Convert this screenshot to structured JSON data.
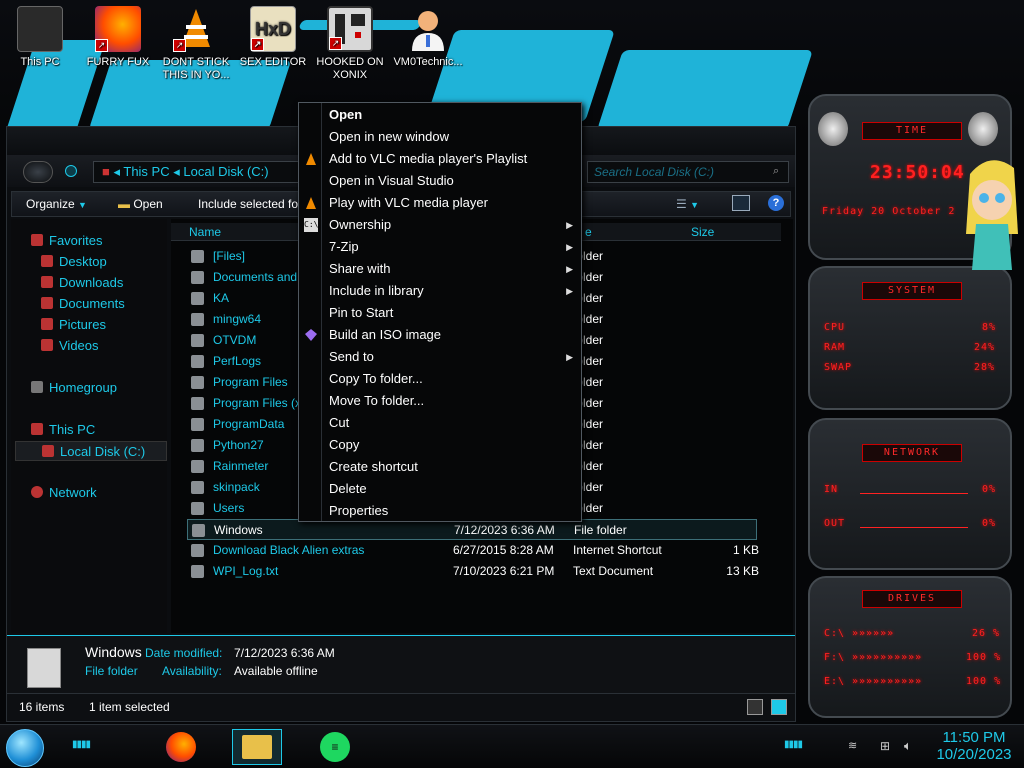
{
  "desktop": {
    "icons": [
      {
        "label": "This PC"
      },
      {
        "label": "FURRY FUX"
      },
      {
        "label": "DONT STICK THIS IN YO..."
      },
      {
        "label": "SEX EDITOR"
      },
      {
        "label": "HOOKED ON XONIX"
      },
      {
        "label": "VM0Technic..."
      }
    ]
  },
  "explorer": {
    "address": [
      "This PC",
      "Local Disk (C:)"
    ],
    "search_placeholder": "Search Local Disk (C:)",
    "toolbar": {
      "organize": "Organize",
      "open": "Open",
      "include": "Include selected fol"
    },
    "sidebar": {
      "favorites": "Favorites",
      "desktop": "Desktop",
      "downloads": "Downloads",
      "documents": "Documents",
      "pictures": "Pictures",
      "videos": "Videos",
      "homegroup": "Homegroup",
      "this_pc": "This PC",
      "local_disk": "Local Disk (C:)",
      "network": "Network"
    },
    "columns": {
      "name": "Name",
      "type": "e",
      "size": "Size"
    },
    "files": [
      {
        "name": "[Files]",
        "date": "",
        "type": "folder",
        "size": ""
      },
      {
        "name": "Documents and Se",
        "date": "",
        "type": "folder",
        "size": ""
      },
      {
        "name": "KA",
        "date": "",
        "type": "folder",
        "size": ""
      },
      {
        "name": "mingw64",
        "date": "",
        "type": "folder",
        "size": ""
      },
      {
        "name": "OTVDM",
        "date": "",
        "type": "folder",
        "size": ""
      },
      {
        "name": "PerfLogs",
        "date": "",
        "type": "folder",
        "size": ""
      },
      {
        "name": "Program Files",
        "date": "",
        "type": "folder",
        "size": ""
      },
      {
        "name": "Program Files (x86",
        "date": "",
        "type": "folder",
        "size": ""
      },
      {
        "name": "ProgramData",
        "date": "",
        "type": "folder",
        "size": ""
      },
      {
        "name": "Python27",
        "date": "",
        "type": "folder",
        "size": ""
      },
      {
        "name": "Rainmeter",
        "date": "",
        "type": "folder",
        "size": ""
      },
      {
        "name": "skinpack",
        "date": "",
        "type": "folder",
        "size": ""
      },
      {
        "name": "Users",
        "date": "",
        "type": "folder",
        "size": ""
      },
      {
        "name": "Windows",
        "date": "7/12/2023 6:36 AM",
        "type": "File folder",
        "size": ""
      },
      {
        "name": "Download Black Alien extras",
        "date": "6/27/2015 8:28 AM",
        "type": "Internet Shortcut",
        "size": "1 KB"
      },
      {
        "name": "WPI_Log.txt",
        "date": "7/10/2023 6:21 PM",
        "type": "Text Document",
        "size": "13 KB"
      }
    ],
    "details": {
      "name": "Windows",
      "date_label": "Date modified:",
      "date_value": "7/12/2023 6:36 AM",
      "type": "File folder",
      "avail_label": "Availability:",
      "avail_value": "Available offline"
    },
    "status": {
      "count": "16 items",
      "selected": "1 item selected"
    }
  },
  "context_menu": [
    {
      "label": "Open",
      "bold": true,
      "submenu": false,
      "icon": ""
    },
    {
      "label": "Open in new window",
      "submenu": false,
      "icon": ""
    },
    {
      "label": "Add to VLC media player's Playlist",
      "submenu": false,
      "icon": "vlc-icon"
    },
    {
      "label": "Open in Visual Studio",
      "submenu": false,
      "icon": ""
    },
    {
      "label": "Play with VLC media player",
      "submenu": false,
      "icon": "vlc-icon"
    },
    {
      "label": "Ownership",
      "submenu": true,
      "icon": "cmd-icon"
    },
    {
      "label": "7-Zip",
      "submenu": true,
      "icon": ""
    },
    {
      "label": "Share with",
      "submenu": true,
      "icon": ""
    },
    {
      "label": "Include in library",
      "submenu": true,
      "icon": ""
    },
    {
      "label": "Pin to Start",
      "submenu": false,
      "icon": ""
    },
    {
      "label": "Build an ISO image",
      "submenu": false,
      "icon": "iso-gem-icon"
    },
    {
      "label": "Send to",
      "submenu": true,
      "icon": ""
    },
    {
      "label": "Copy To folder...",
      "submenu": false,
      "icon": ""
    },
    {
      "label": "Move To folder...",
      "submenu": false,
      "icon": ""
    },
    {
      "label": "Cut",
      "submenu": false,
      "icon": ""
    },
    {
      "label": "Copy",
      "submenu": false,
      "icon": ""
    },
    {
      "label": "Create shortcut",
      "submenu": false,
      "icon": ""
    },
    {
      "label": "Delete",
      "submenu": false,
      "icon": ""
    },
    {
      "label": "Properties",
      "submenu": false,
      "icon": ""
    }
  ],
  "rainmeter": {
    "time": {
      "title": "TIME",
      "clock": "23:50:04",
      "date": "Friday 20 October 2"
    },
    "system": {
      "title": "SYSTEM",
      "cpu_label": "CPU",
      "cpu_val": "8%",
      "ram_label": "RAM",
      "ram_val": "24%",
      "swap_label": "SWAP",
      "swap_val": "28%"
    },
    "network": {
      "title": "NETWORK",
      "in_label": "IN",
      "in_val": "0%",
      "out_label": "OUT",
      "out_val": "0%"
    },
    "drives": {
      "title": "DRIVES",
      "c_label": "C:\\",
      "c_val": "26 %",
      "f_label": "F:\\",
      "f_val": "100 %",
      "e_label": "E:\\",
      "e_val": "100 %"
    }
  },
  "taskbar": {
    "time": "11:50 PM",
    "date": "10/20/2023"
  },
  "colors": {
    "accent": "#1ec9e8",
    "rain_red": "#ff2020"
  }
}
